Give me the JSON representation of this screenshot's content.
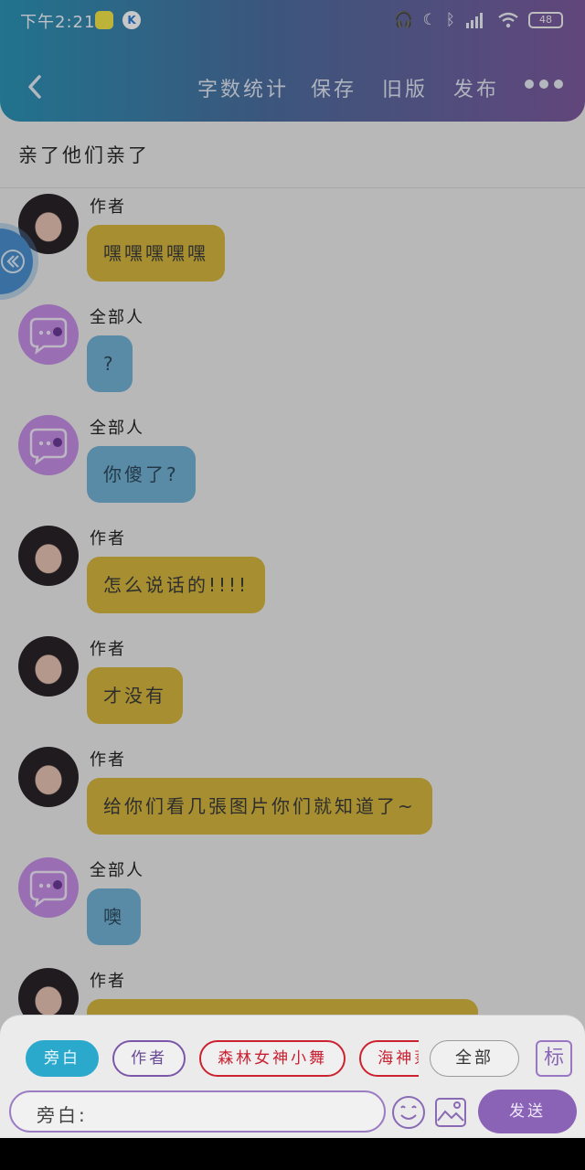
{
  "status_bar": {
    "time": "下午2:21",
    "app_badge": "K",
    "battery": "48"
  },
  "nav": {
    "word_count": "字数统计",
    "save": "保存",
    "old_version": "旧版",
    "publish": "发布"
  },
  "story_title": "亲了他们亲了",
  "messages": [
    {
      "sender": "作者",
      "text": "嘿嘿嘿嘿嘿"
    },
    {
      "sender": "全部人",
      "text": "?"
    },
    {
      "sender": "全部人",
      "text": "你傻了?"
    },
    {
      "sender": "作者",
      "text": "怎么说话的!!!!"
    },
    {
      "sender": "作者",
      "text": "才没有"
    },
    {
      "sender": "作者",
      "text": "给你们看几張图片你们就知道了~"
    },
    {
      "sender": "全部人",
      "text": "噢"
    },
    {
      "sender": "作者",
      "text": ""
    }
  ],
  "role_chips": [
    "旁白",
    "作者",
    "森林女神小舞",
    "海神蒹儿"
  ],
  "all_chip": "全部",
  "mark_chip": "标",
  "input": {
    "label": "旁白:"
  },
  "send_label": "发送",
  "colors": {
    "author_bubble": "#d6b73e",
    "all_bubble": "#72b3d6",
    "accent_purple": "#8a63b6",
    "active_chip": "#2aa9cc"
  }
}
